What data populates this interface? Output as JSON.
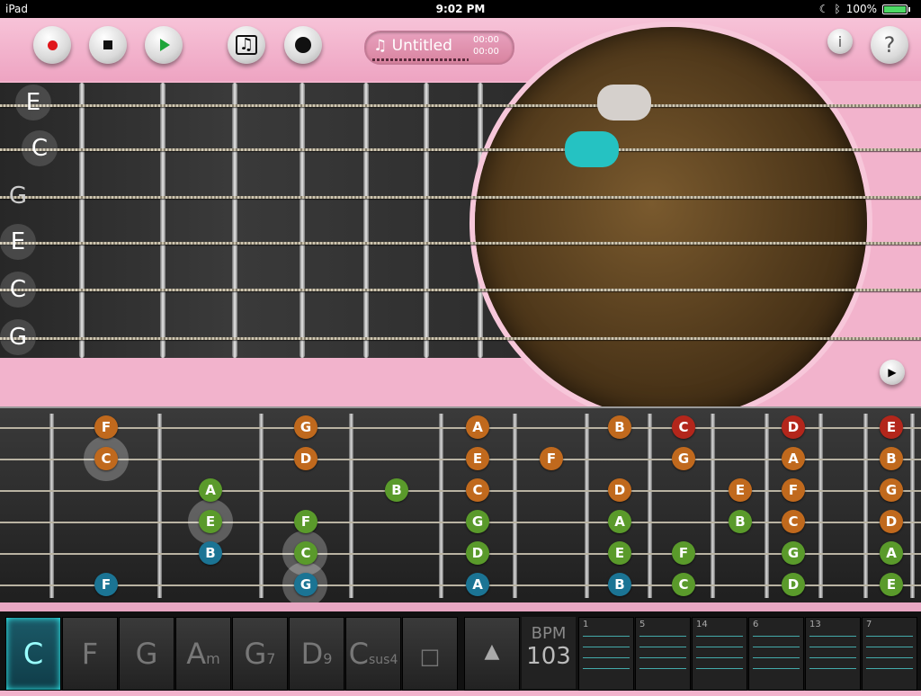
{
  "status": {
    "device": "iPad",
    "time": "9:02 PM",
    "battery": "100%"
  },
  "toolbar": {
    "song_title": "Untitled",
    "time_elapsed": "00:00",
    "time_total": "00:00"
  },
  "tuning": [
    "E",
    "C",
    "G",
    "E",
    "C",
    "G"
  ],
  "fretboard_notes": [
    {
      "label": "F",
      "color": "orange"
    },
    {
      "label": "G",
      "color": "orange"
    },
    {
      "label": "A",
      "color": "orange"
    },
    {
      "label": "B",
      "color": "orange"
    },
    {
      "label": "C",
      "color": "red"
    },
    {
      "label": "D",
      "color": "red"
    },
    {
      "label": "E",
      "color": "red"
    },
    {
      "label": "C",
      "color": "orange"
    },
    {
      "label": "D",
      "color": "orange"
    },
    {
      "label": "E",
      "color": "orange"
    },
    {
      "label": "F",
      "color": "orange"
    },
    {
      "label": "G",
      "color": "orange"
    },
    {
      "label": "A",
      "color": "orange"
    },
    {
      "label": "B",
      "color": "orange"
    },
    {
      "label": "A",
      "color": "green"
    },
    {
      "label": "B",
      "color": "green"
    },
    {
      "label": "C",
      "color": "orange"
    },
    {
      "label": "D",
      "color": "orange"
    },
    {
      "label": "E",
      "color": "orange"
    },
    {
      "label": "F",
      "color": "orange"
    },
    {
      "label": "G",
      "color": "orange"
    },
    {
      "label": "E",
      "color": "green"
    },
    {
      "label": "F",
      "color": "green"
    },
    {
      "label": "G",
      "color": "green"
    },
    {
      "label": "A",
      "color": "green"
    },
    {
      "label": "B",
      "color": "green"
    },
    {
      "label": "C",
      "color": "orange"
    },
    {
      "label": "D",
      "color": "orange"
    },
    {
      "label": "B",
      "color": "teal"
    },
    {
      "label": "C",
      "color": "green"
    },
    {
      "label": "D",
      "color": "green"
    },
    {
      "label": "E",
      "color": "green"
    },
    {
      "label": "F",
      "color": "green"
    },
    {
      "label": "G",
      "color": "green"
    },
    {
      "label": "A",
      "color": "green"
    },
    {
      "label": "F",
      "color": "teal"
    },
    {
      "label": "G",
      "color": "teal"
    },
    {
      "label": "A",
      "color": "teal"
    },
    {
      "label": "B",
      "color": "teal"
    },
    {
      "label": "C",
      "color": "green"
    },
    {
      "label": "D",
      "color": "green"
    },
    {
      "label": "E",
      "color": "green"
    }
  ],
  "chords": [
    {
      "root": "C",
      "suffix": ""
    },
    {
      "root": "F",
      "suffix": ""
    },
    {
      "root": "G",
      "suffix": ""
    },
    {
      "root": "A",
      "suffix": "m"
    },
    {
      "root": "G",
      "suffix": "7"
    },
    {
      "root": "D",
      "suffix": "9"
    },
    {
      "root": "C",
      "suffix": "sus4"
    },
    {
      "root": "□",
      "suffix": ""
    }
  ],
  "bpm": {
    "label": "BPM",
    "value": "103"
  },
  "patterns": [
    "1",
    "5",
    "14",
    "6",
    "13",
    "7"
  ]
}
